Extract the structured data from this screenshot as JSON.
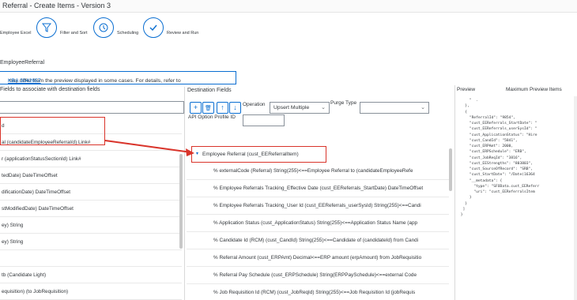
{
  "window": {
    "title": "Referral - Create Items - Version 3"
  },
  "steps": [
    {
      "label": "Employee Excel",
      "icon": "excel-icon"
    },
    {
      "label": "Filter and Sort",
      "icon": "filter-icon"
    },
    {
      "label": "Scheduling",
      "icon": "clock-icon"
    },
    {
      "label": "Review and Run",
      "icon": "check-icon"
    }
  ],
  "entity_name": "EmployeeReferral",
  "notice": {
    "text": "may differ from the preview displayed in some cases. For details, refer to",
    "link": "KBA 3042657"
  },
  "source": {
    "header": "Fields to associate with destination fields",
    "items": [
      "d",
      "al (candidateEmployeeReferral/d) Link#",
      "r (applicationStatusSectionId) Link#",
      "tedDate) DateTimeOffset",
      "dificationDate) DateTimeOffset",
      "stModifiedDate) DateTimeOffset",
      "ey) String",
      "ey) String",
      "",
      "tb (Candidate Light)",
      "equisition) (to JobRequisition)"
    ]
  },
  "destination": {
    "header": "Destination Fields",
    "toolbar": {
      "add": "+",
      "delete": "🗑",
      "up": "↑",
      "down": "↓"
    },
    "operation": {
      "label": "Operation",
      "value": "Upsert Multiple"
    },
    "purge": {
      "label": "Purge Type",
      "value": ""
    },
    "api_user_label": "API Option Profile ID",
    "root": "Employee Referral (cust_EEReferralItem)",
    "rows": [
      "externalCode (Referral) String(255)<==Employee Referral to (candidateEmployeeRefe",
      "Employee Referrals Tracking_Effective Date (cust_EEReferrals_StartDate) DateTimeOffset",
      "Employee Referrals Tracking_User Id (cust_EEReferrals_userSysId) String(255)<==Candi",
      "Application Status (cust_ApplicationStatus) String(255)<==Application Status Name (app",
      "Candidate Id (RCM) (cust_CandId) String(255)<==Candidate of (candidateId) from Candi",
      "Referral Amount (cust_ERPAmt) Decimal<==ERP amount (erpAmount) from JobRequisitio",
      "Referral Pay Schedule (cust_ERPSchedule) String(ERPPaySchedule)<==external Code",
      "Job Requisition Id (RCM) (cust_JobReqId) String(255)<==Job Requisition Id (jobRequis"
    ]
  },
  "preview": {
    "tabs": [
      "Preview",
      "Maximum Preview Items"
    ],
    "code": "     \"  .\n   },\n   {\n     \"ReferralId\": \"9854\",\n     \"cust_EEReferrals_StartDate\": \"\n     \"cust_EEReferrals_userSysId\": \"\n     \"cust_ApplicationStatus\": \"Hire\n     \"cust_CandId\": \"5841\",\n     \"cust_ERPAmt\": 2000,\n     \"cust_ERPSchedule\": \"ERB\",\n     \"cust_JobReqId\": \"3816\",\n     \"cust_EEStrengths\": \"803803\",\n     \"cust_SourceOfRecord\": \"SRB\",\n     \"cust_StartDate\": \"/Date(16364\n     \"__metadata\": {\n       \"type\": \"SFOData.cust_EEReferr\n       \"uri\": \"cust_EEReferralsItem\n     }\n   }\n  ]\n }"
  }
}
